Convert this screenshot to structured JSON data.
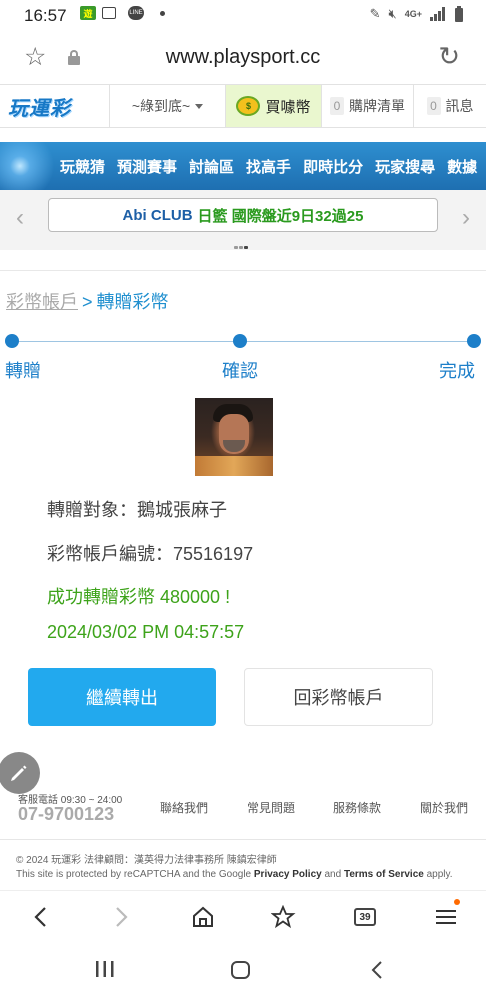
{
  "status_bar": {
    "time": "16:57",
    "game_icon_text": "遊",
    "line_icon_text": "LINE",
    "network": "4G+"
  },
  "browser": {
    "url": "www.playsport.cc",
    "tabs_count": "39"
  },
  "header": {
    "logo": "玩運彩",
    "user_select": "~綠到底~",
    "buy_coin": "買噱幣",
    "cart_count": "0",
    "cart_label": "購牌清單",
    "msg_count": "0",
    "msg_label": "訊息"
  },
  "nav": {
    "items": [
      "玩競猜",
      "預測賽事",
      "討論區",
      "找高手",
      "即時比分",
      "玩家搜尋",
      "數據"
    ]
  },
  "ticker": {
    "club": "Abi CLUB",
    "text": "日籃 國際盤近9日32過25"
  },
  "breadcrumb": {
    "parent": "彩幣帳戶",
    "separator": ">",
    "current": "轉贈彩幣"
  },
  "steps": [
    "轉贈",
    "確認",
    "完成"
  ],
  "transfer": {
    "target": "轉贈對象：鵝城張麻子",
    "account": "彩幣帳戶編號：75516197",
    "success": "成功轉贈彩幣 480000 !",
    "datetime": "2024/03/02 PM 04:57:57"
  },
  "buttons": {
    "continue": "繼續轉出",
    "back": "回彩幣帳戶"
  },
  "footer": {
    "hotline_label": "客服電話 09:30 ~ 24:00",
    "hotline_number": "07-9700123",
    "links": [
      "聯絡我們",
      "常見問題",
      "服務條款",
      "關於我們"
    ],
    "copyright": "© 2024 玩運彩 法律顧問：漢英得力法律事務所 陳鎮宏律師",
    "recaptcha_pre": "This site is protected by reCAPTCHA and the Google ",
    "privacy": "Privacy Policy",
    "and": " and ",
    "terms": "Terms of Service",
    "recaptcha_post": " apply."
  },
  "colors": {
    "brand_blue": "#1d7fc9",
    "button_blue": "#22a9ee",
    "success_green": "#3da31a",
    "coin_bg": "#eaf7cf"
  }
}
